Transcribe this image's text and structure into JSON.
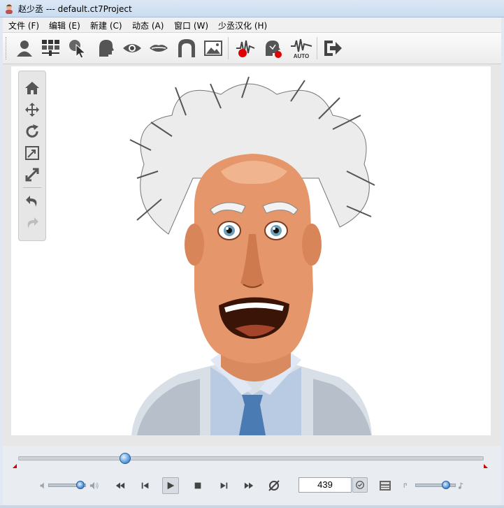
{
  "window": {
    "title": "赵少丞 --- default.ct7Project",
    "icon": "app-avatar-icon"
  },
  "menubar": {
    "items": [
      {
        "label": "文件 (F)"
      },
      {
        "label": "编辑 (E)"
      },
      {
        "label": "新建 (C)"
      },
      {
        "label": "动态 (A)"
      },
      {
        "label": "窗口 (W)"
      },
      {
        "label": "少丞汉化 (H)"
      }
    ]
  },
  "toolbar": {
    "tools": [
      {
        "icon": "person-icon"
      },
      {
        "icon": "grid-panel-icon"
      },
      {
        "icon": "select-pointer-icon"
      },
      {
        "icon": "head-icon"
      },
      {
        "icon": "eye-icon"
      },
      {
        "icon": "mouth-icon"
      },
      {
        "icon": "face-outline-icon"
      },
      {
        "icon": "image-icon"
      },
      {
        "icon": "record-audio-icon"
      },
      {
        "icon": "record-voice-icon"
      },
      {
        "icon": "auto-lipsync-icon",
        "label": "AUTO"
      },
      {
        "icon": "exit-icon"
      }
    ]
  },
  "view_tools": {
    "items": [
      {
        "icon": "home-icon"
      },
      {
        "icon": "move-icon"
      },
      {
        "icon": "rotate-icon"
      },
      {
        "icon": "scale-icon"
      },
      {
        "icon": "expand-icon"
      },
      {
        "icon": "undo-icon"
      },
      {
        "icon": "redo-icon"
      }
    ]
  },
  "stage": {
    "content": "cartoon-scientist-character"
  },
  "playback": {
    "timeline_position": 0.23,
    "volume": 0.85,
    "current_frame": "439",
    "speed": 0.75,
    "buttons": [
      {
        "icon": "rewind-icon"
      },
      {
        "icon": "previous-frame-icon"
      },
      {
        "icon": "play-icon"
      },
      {
        "icon": "stop-icon"
      },
      {
        "icon": "next-frame-icon"
      },
      {
        "icon": "fast-forward-icon"
      },
      {
        "icon": "loop-off-icon"
      }
    ]
  },
  "colors": {
    "accent": "#3f86d0",
    "marker": "#d00000",
    "record": "#e00000"
  }
}
